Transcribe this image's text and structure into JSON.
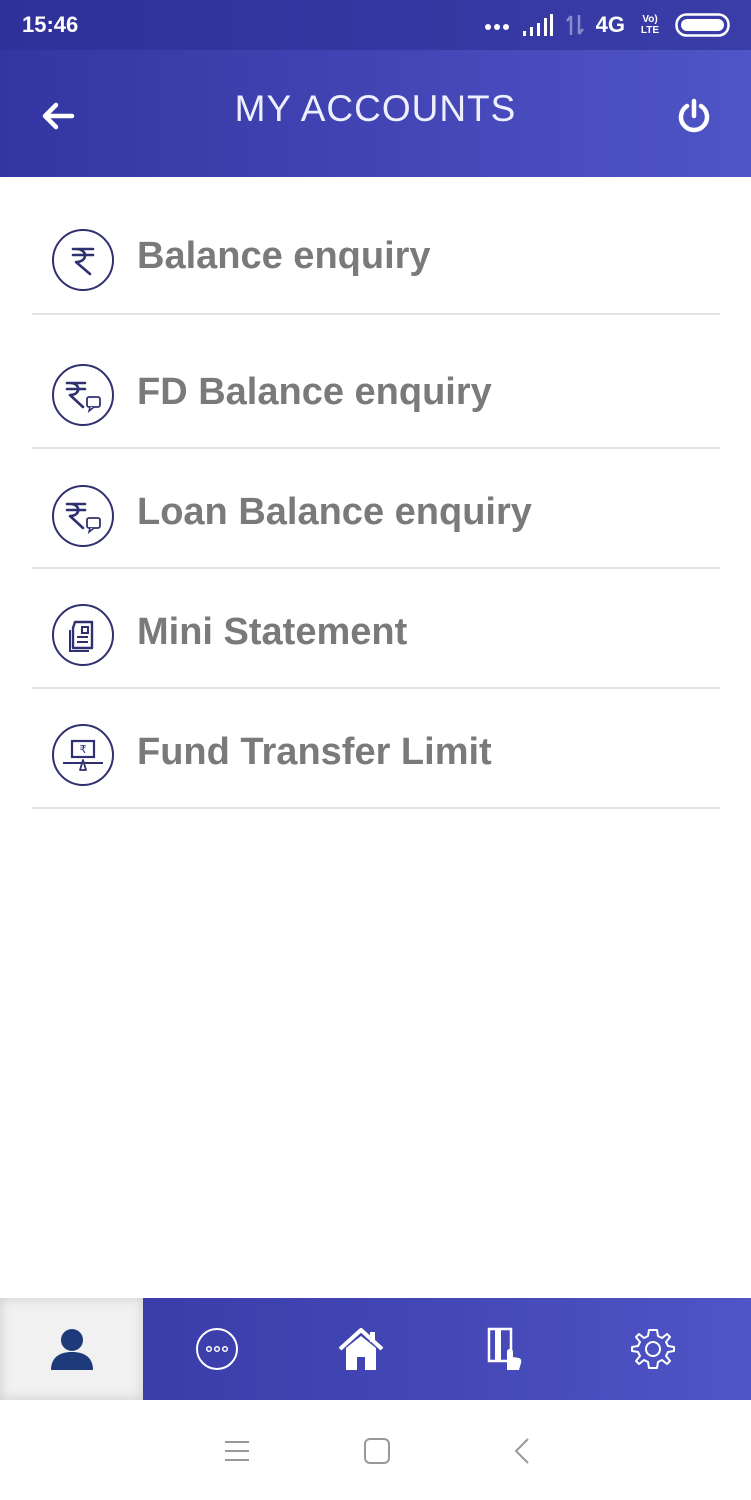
{
  "status_bar": {
    "time": "15:46",
    "network": "4G",
    "volte": "Vo) LTE",
    "icons": [
      "more-dots-icon",
      "signal-icon",
      "data-arrows-icon",
      "battery-icon"
    ]
  },
  "header": {
    "title": "MY ACCOUNTS",
    "back_icon": "back-arrow-icon",
    "power_icon": "power-icon"
  },
  "menu": {
    "items": [
      {
        "label": "Balance enquiry",
        "icon": "rupee-icon"
      },
      {
        "label": "FD Balance enquiry",
        "icon": "rupee-chat-icon"
      },
      {
        "label": "Loan Balance enquiry",
        "icon": "rupee-chat-icon"
      },
      {
        "label": "Mini Statement",
        "icon": "statement-icon"
      },
      {
        "label": "Fund Transfer Limit",
        "icon": "laptop-rupee-icon"
      }
    ]
  },
  "bottom_nav": {
    "active_index": 0,
    "tabs": [
      {
        "icon": "user-icon"
      },
      {
        "icon": "more-circle-icon"
      },
      {
        "icon": "home-icon"
      },
      {
        "icon": "card-tap-icon"
      },
      {
        "icon": "settings-gear-icon"
      }
    ]
  },
  "system_nav": {
    "icons": [
      "menu-lines-icon",
      "home-square-icon",
      "back-chevron-icon"
    ]
  },
  "colors": {
    "header": "#3f42ae",
    "label": "#7a7a7a",
    "icon_stroke": "#2f3070",
    "divider": "#e3e3e3"
  }
}
